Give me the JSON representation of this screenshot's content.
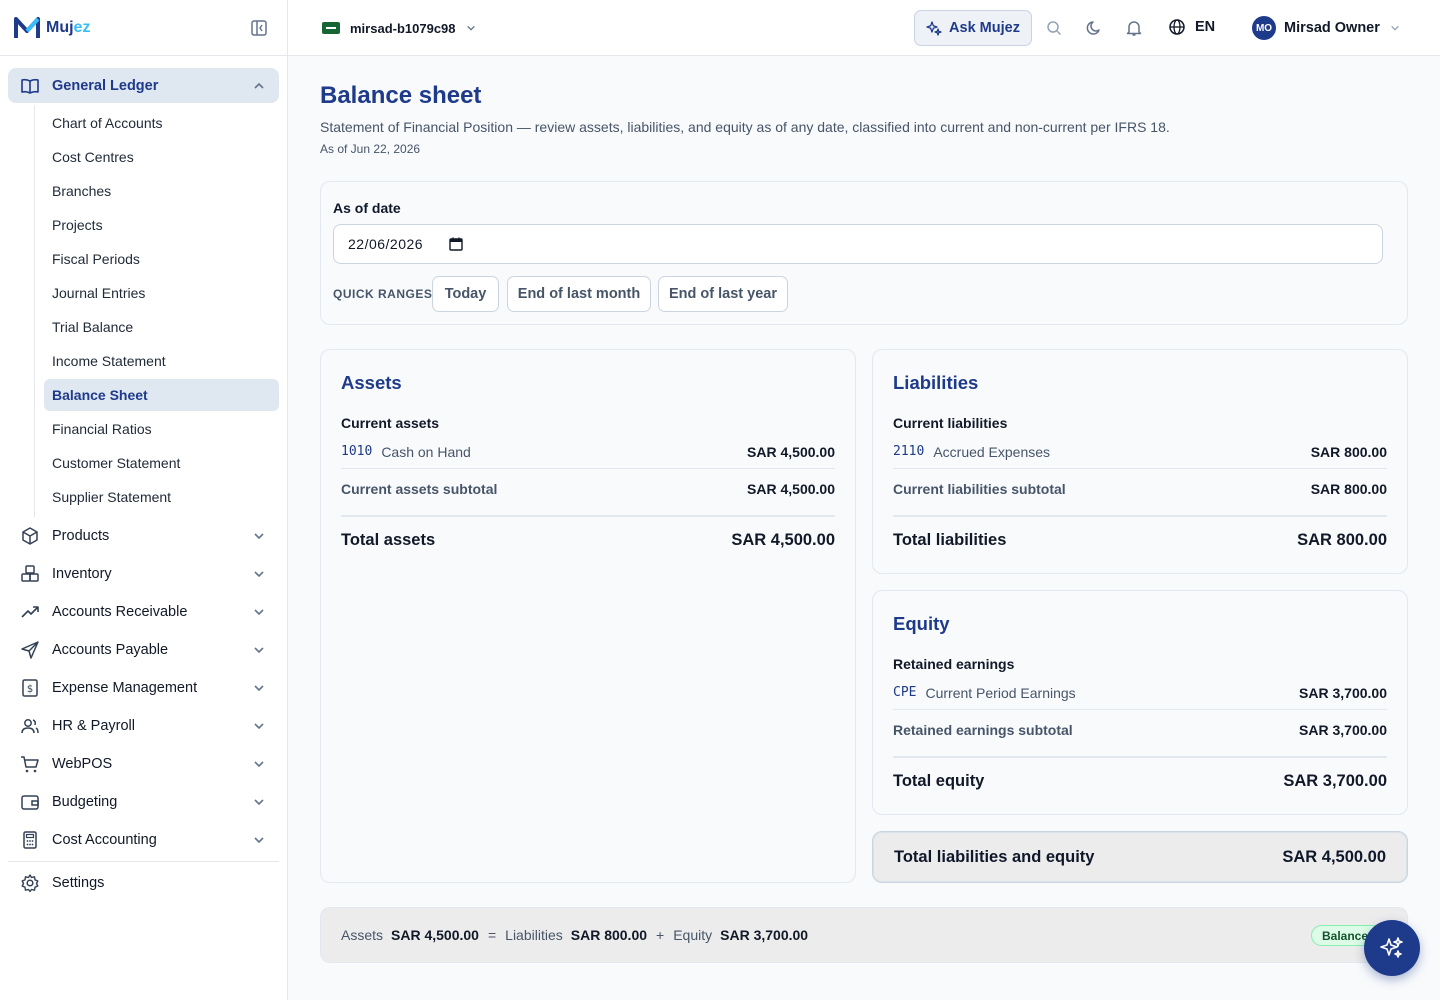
{
  "brand": {
    "name_main": "Muj",
    "name_accent": "ez"
  },
  "sidebar": {
    "group": {
      "label": "General Ledger",
      "items": [
        {
          "label": "Chart of Accounts",
          "active": false
        },
        {
          "label": "Cost Centres",
          "active": false
        },
        {
          "label": "Branches",
          "active": false
        },
        {
          "label": "Projects",
          "active": false
        },
        {
          "label": "Fiscal Periods",
          "active": false
        },
        {
          "label": "Journal Entries",
          "active": false
        },
        {
          "label": "Trial Balance",
          "active": false
        },
        {
          "label": "Income Statement",
          "active": false
        },
        {
          "label": "Balance Sheet",
          "active": true
        },
        {
          "label": "Financial Ratios",
          "active": false
        },
        {
          "label": "Customer Statement",
          "active": false
        },
        {
          "label": "Supplier Statement",
          "active": false
        }
      ]
    },
    "modules": [
      {
        "label": "Products",
        "icon": "box-icon"
      },
      {
        "label": "Inventory",
        "icon": "boxes-icon"
      },
      {
        "label": "Accounts Receivable",
        "icon": "trending-up-icon"
      },
      {
        "label": "Accounts Payable",
        "icon": "send-icon"
      },
      {
        "label": "Expense Management",
        "icon": "receipt-dollar-icon"
      },
      {
        "label": "HR & Payroll",
        "icon": "users-icon"
      },
      {
        "label": "WebPOS",
        "icon": "cart-icon"
      },
      {
        "label": "Budgeting",
        "icon": "wallet-icon"
      },
      {
        "label": "Cost Accounting",
        "icon": "calculator-icon"
      }
    ],
    "settings": "Settings"
  },
  "topbar": {
    "org": "mirsad-b1079c98",
    "ask": "Ask Mujez",
    "lang": "EN",
    "user_initials": "MO",
    "user_name": "Mirsad Owner"
  },
  "page": {
    "title": "Balance sheet",
    "description": "Statement of Financial Position — review assets, liabilities, and equity as of any date, classified into current and non-current per IFRS 18.",
    "as_of": "As of Jun 22, 2026"
  },
  "filter": {
    "label": "As of date",
    "date_value": "22/06/2026",
    "quick_ranges_label": "QUICK RANGES",
    "quick_ranges": [
      "Today",
      "End of last month",
      "End of last year"
    ]
  },
  "assets": {
    "title": "Assets",
    "section": "Current assets",
    "lines": [
      {
        "code": "1010",
        "name": "Cash on Hand",
        "amount": "SAR 4,500.00"
      }
    ],
    "subtotal_label": "Current assets subtotal",
    "subtotal": "SAR 4,500.00",
    "total_label": "Total assets",
    "total": "SAR 4,500.00"
  },
  "liabilities": {
    "title": "Liabilities",
    "section": "Current liabilities",
    "lines": [
      {
        "code": "2110",
        "name": "Accrued Expenses",
        "amount": "SAR 800.00"
      }
    ],
    "subtotal_label": "Current liabilities subtotal",
    "subtotal": "SAR 800.00",
    "total_label": "Total liabilities",
    "total": "SAR 800.00"
  },
  "equity": {
    "title": "Equity",
    "section": "Retained earnings",
    "lines": [
      {
        "code": "CPE",
        "name": "Current Period Earnings",
        "amount": "SAR 3,700.00"
      }
    ],
    "subtotal_label": "Retained earnings subtotal",
    "subtotal": "SAR 3,700.00",
    "total_label": "Total equity",
    "total": "SAR 3,700.00"
  },
  "total_le": {
    "label": "Total liabilities and equity",
    "amount": "SAR 4,500.00"
  },
  "equation": {
    "assets_label": "Assets",
    "assets": "SAR 4,500.00",
    "eq": "=",
    "liabilities_label": "Liabilities",
    "liabilities": "SAR 800.00",
    "plus": "+",
    "equity_label": "Equity",
    "equity": "SAR 3,700.00",
    "status": "Balanced"
  },
  "colors": {
    "brand": "#1e3a8a",
    "accent": "#38bdf8",
    "active_bg": "#dfe7f1",
    "balanced": "#dcfce7"
  }
}
